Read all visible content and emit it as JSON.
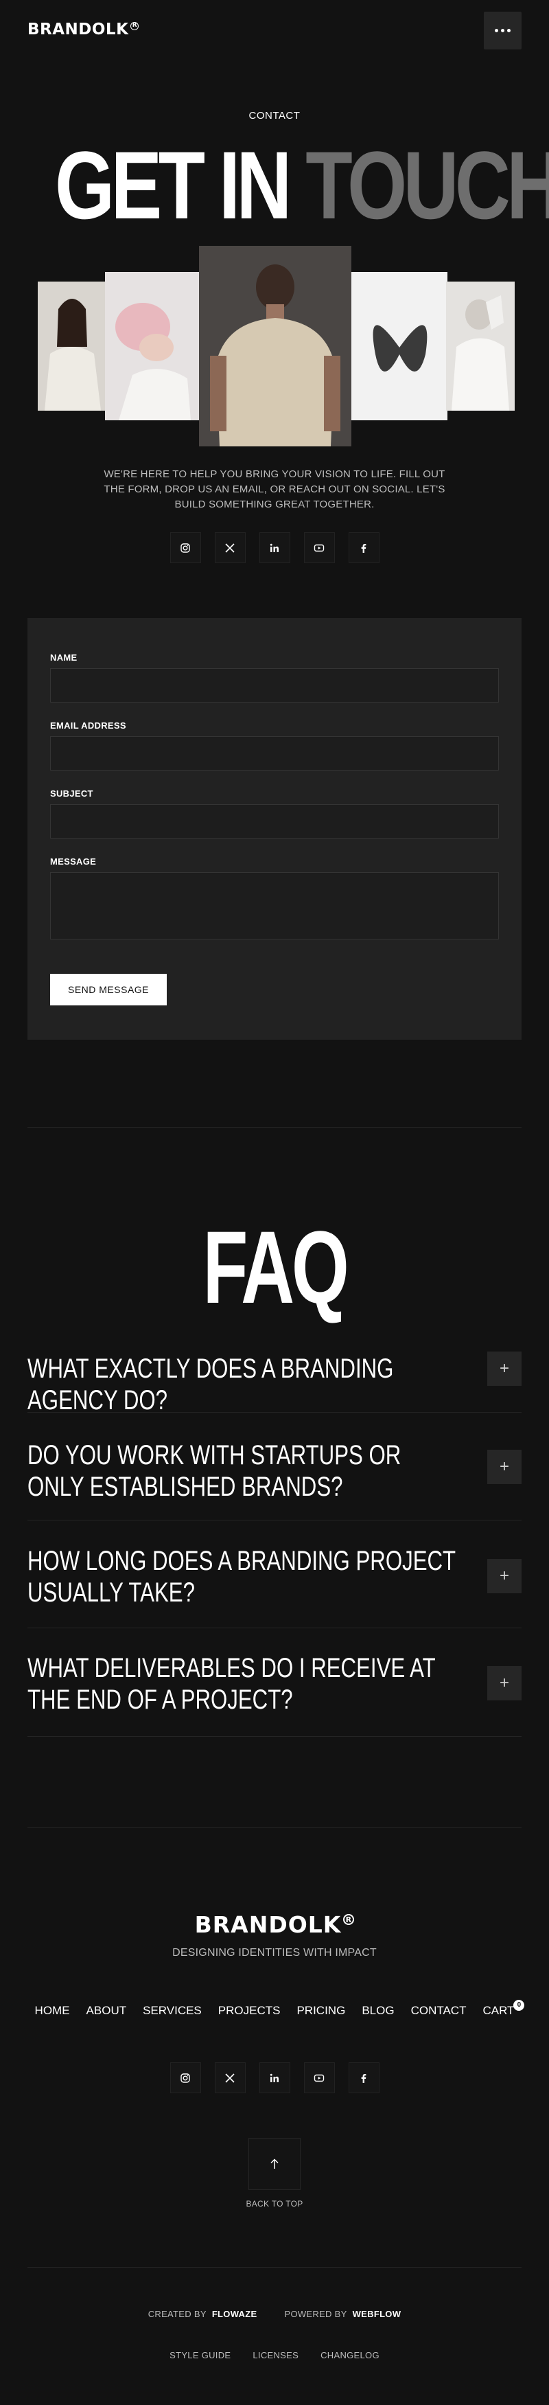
{
  "header": {
    "logo": "BRANDOLK",
    "reg_mark": "R"
  },
  "hero": {
    "eyebrow": "CONTACT",
    "title_part1": "GET IN",
    "title_part2": "TOUCH",
    "intro": "WE'RE HERE TO HELP YOU BRING YOUR VISION TO LIFE. FILL OUT THE FORM, DROP US AN EMAIL, OR REACH OUT ON SOCIAL. LET'S BUILD SOMETHING GREAT TOGETHER."
  },
  "socials": [
    "instagram-icon",
    "x-icon",
    "linkedin-icon",
    "youtube-icon",
    "facebook-icon"
  ],
  "form": {
    "name_label": "NAME",
    "email_label": "EMAIL ADDRESS",
    "subject_label": "SUBJECT",
    "message_label": "MESSAGE",
    "submit_label": "SEND MESSAGE"
  },
  "faq": {
    "title": "FAQ",
    "toggle": "+",
    "items": [
      {
        "question": "WHAT EXACTLY DOES A BRANDING AGENCY DO?"
      },
      {
        "question": "DO YOU WORK WITH STARTUPS OR ONLY ESTABLISHED BRANDS?"
      },
      {
        "question": "HOW LONG DOES A BRANDING PROJECT USUALLY TAKE?"
      },
      {
        "question": "WHAT DELIVERABLES DO I RECEIVE AT THE END OF A PROJECT?"
      }
    ]
  },
  "footer": {
    "logo": "BRANDOLK",
    "reg_mark": "R",
    "tagline": "DESIGNING IDENTITIES WITH IMPACT",
    "nav": [
      "HOME",
      "ABOUT",
      "SERVICES",
      "PROJECTS",
      "PRICING",
      "BLOG",
      "CONTACT",
      "CART"
    ],
    "cart_count": "0",
    "back_to_top": "BACK TO TOP",
    "created_by_label": "CREATED BY",
    "created_by_value": "FLOWAZE",
    "powered_by_label": "POWERED BY",
    "powered_by_value": "WEBFLOW",
    "legal": [
      "STYLE GUIDE",
      "LICENSES",
      "CHANGELOG"
    ]
  },
  "colors": {
    "background": "#121212",
    "card": "#222222",
    "muted_text": "#6e6e6e"
  }
}
